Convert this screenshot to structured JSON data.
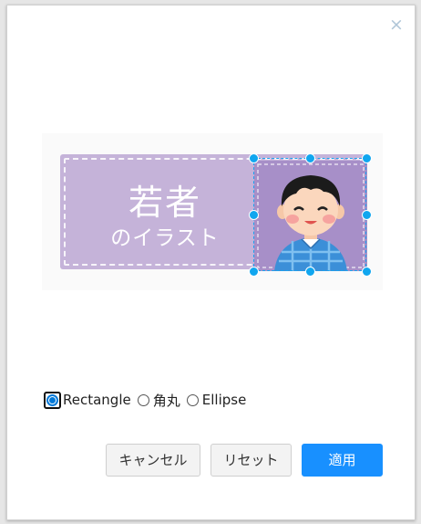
{
  "dialog": {
    "close_symbol": "×",
    "close_icon": "close-icon"
  },
  "image": {
    "banner_title": "若者",
    "banner_subtitle": "のイラスト"
  },
  "shape_options": [
    {
      "label": "Rectangle",
      "checked": true
    },
    {
      "label": "角丸",
      "checked": false
    },
    {
      "label": "Ellipse",
      "checked": false
    }
  ],
  "buttons": {
    "cancel": "キャンセル",
    "reset": "リセット",
    "apply": "適用"
  },
  "colors": {
    "accent": "#1890ff",
    "handle": "#10a6ef",
    "banner": "#c5b3d9"
  }
}
